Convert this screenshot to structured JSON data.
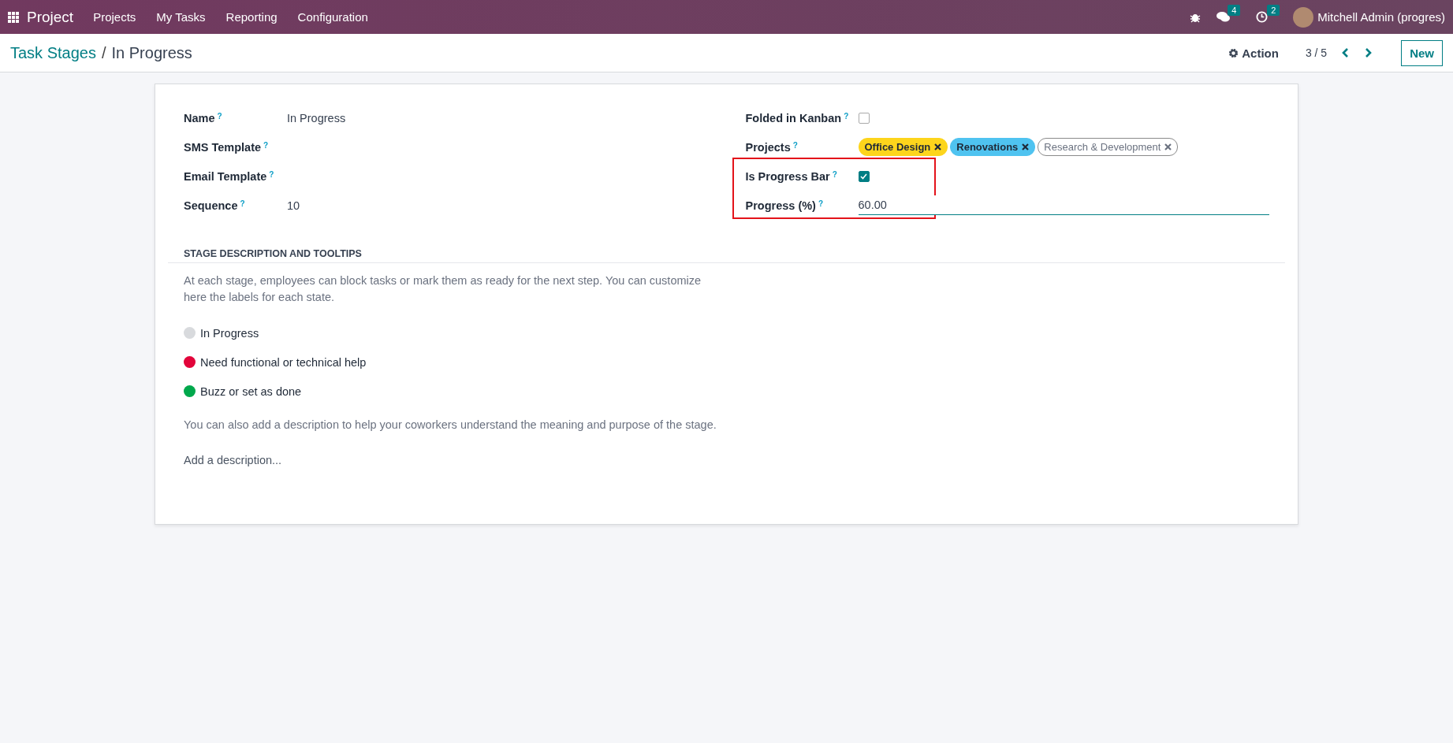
{
  "navbar": {
    "app_name": "Project",
    "menu": [
      "Projects",
      "My Tasks",
      "Reporting",
      "Configuration"
    ],
    "messages_count": "4",
    "activities_count": "2",
    "user": "Mitchell Admin (progres)"
  },
  "breadcrumb": {
    "parent": "Task Stages",
    "separator": "/",
    "current": "In Progress"
  },
  "control_panel": {
    "action": "Action",
    "pager": "3 / 5",
    "new_button": "New"
  },
  "form": {
    "left_fields": [
      {
        "label": "Name",
        "help": "?",
        "value": "In Progress"
      },
      {
        "label": "SMS Template",
        "help": "?"
      },
      {
        "label": "Email Template",
        "help": "?"
      },
      {
        "label": "Sequence",
        "help": "?",
        "value": "10"
      }
    ],
    "folded_in_kanban": {
      "label": "Folded in Kanban",
      "help": "?",
      "checked": false
    },
    "projects": {
      "label": "Projects",
      "help": "?",
      "tags": [
        {
          "name": "Office Design",
          "color": "#fdd51c"
        },
        {
          "name": "Renovations",
          "color": "#4fc3f0"
        },
        {
          "name": "Research & Development",
          "color": "#ffffff"
        }
      ]
    },
    "is_progress_bar": {
      "label": "Is Progress Bar",
      "help": "?",
      "checked": true
    },
    "progress": {
      "label": "Progress (%)",
      "help": "?",
      "value": "60.00"
    },
    "section_title": "STAGE DESCRIPTION AND TOOLTIPS",
    "intro": "At each stage, employees can block tasks or mark them as ready for the next step. You can customize here the labels for each state.",
    "states": [
      {
        "label": "In Progress",
        "color": "#d8dadd"
      },
      {
        "label": "Need functional or technical help",
        "color": "#e2043a"
      },
      {
        "label": "Buzz or set as done",
        "color": "#00a84c"
      }
    ],
    "description_hint": "You can also add a description to help your coworkers understand the meaning and purpose of the stage.",
    "description_placeholder": "Add a description..."
  }
}
